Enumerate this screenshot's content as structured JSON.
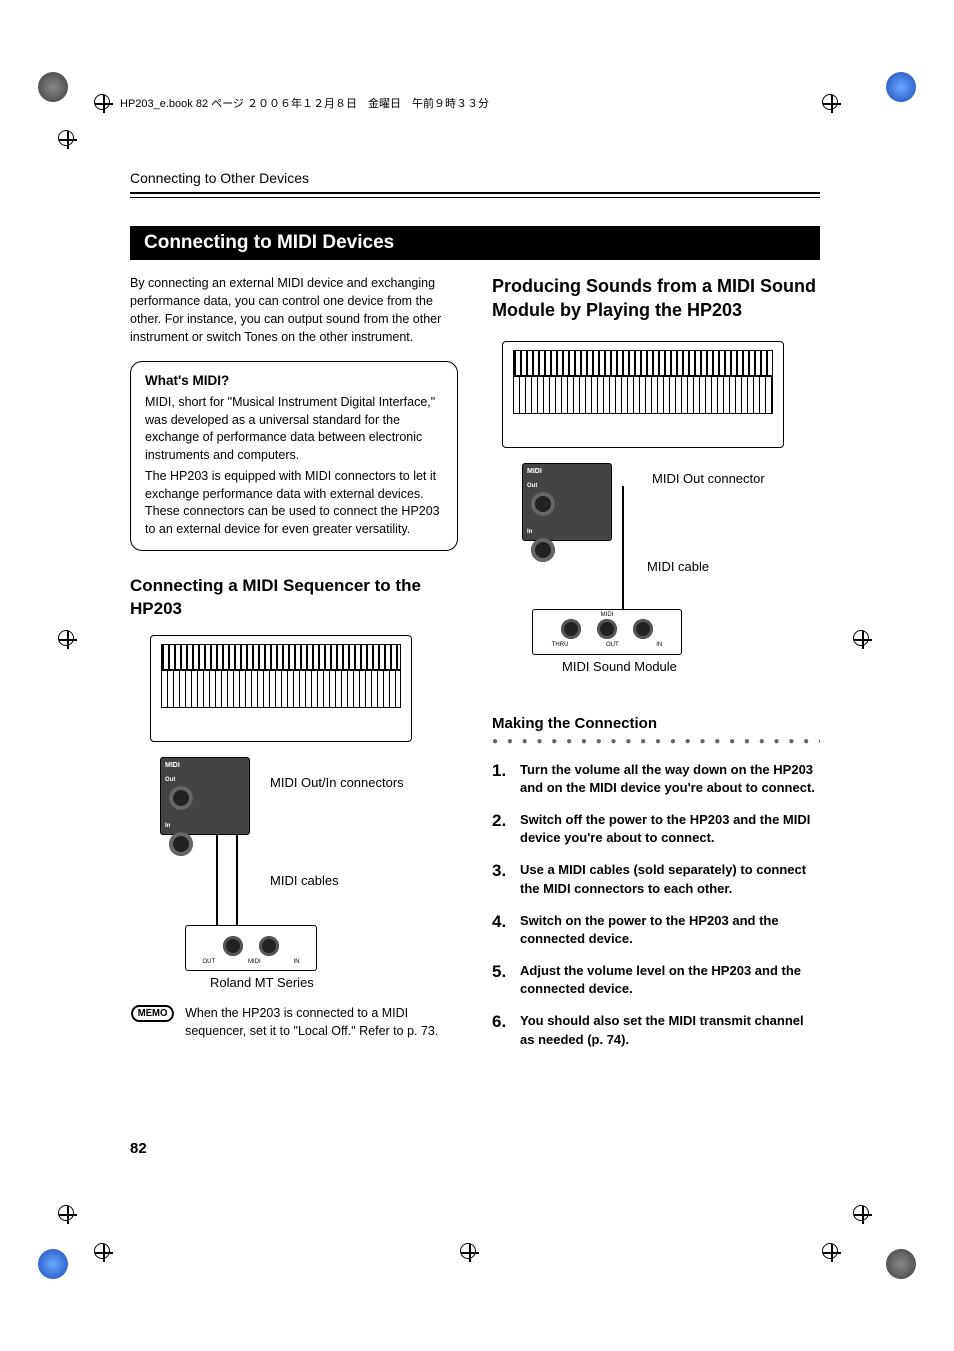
{
  "header_jp": "HP203_e.book  82 ページ  ２００６年１２月８日　金曜日　午前９時３３分",
  "breadcrumb": "Connecting to Other Devices",
  "section_title": "Connecting to MIDI Devices",
  "intro": "By connecting an external MIDI device and exchanging performance data, you can control one device from the other. For instance, you can output sound from the other instrument or switch Tones on the other instrument.",
  "callout": {
    "title": "What's MIDI?",
    "p1": "MIDI, short for \"Musical Instrument Digital Interface,\" was developed as a universal standard for the exchange of performance data between electronic instruments and computers.",
    "p2": "The HP203 is equipped with MIDI connectors to let it exchange performance data with external devices. These connectors can be used to connect the HP203 to an external device for even greater versatility."
  },
  "left": {
    "heading": "Connecting a MIDI Sequencer to the HP203",
    "label_connectors": "MIDI Out/In connectors",
    "label_cables": "MIDI cables",
    "label_unit": "Roland MT Series",
    "panel_midi": "MIDI",
    "panel_out": "Out",
    "panel_in": "In",
    "ext_out": "OUT",
    "ext_midi": "MIDI",
    "ext_in": "IN"
  },
  "memo": {
    "label": "MEMO",
    "text": "When the HP203 is connected to a MIDI sequencer, set it to \"Local Off.\" Refer to p. 73."
  },
  "right": {
    "heading": "Producing Sounds from a MIDI Sound Module by Playing the HP203",
    "label_out": "MIDI Out connector",
    "label_cable": "MIDI cable",
    "label_module": "MIDI Sound Module",
    "panel_midi": "MIDI",
    "panel_out": "Out",
    "panel_in": "In",
    "ext_thru": "THRU",
    "ext_out_port": "OUT",
    "ext_in_port": "IN",
    "ext_header": "MIDI"
  },
  "making_connection": "Making the Connection",
  "steps": [
    "Turn the volume all the way down on the HP203 and on the MIDI device you're about to connect.",
    "Switch off the power to the HP203 and the MIDI device you're about to connect.",
    "Use a MIDI cables (sold separately) to connect the MIDI connectors to each other.",
    "Switch on the power to the HP203 and the connected device.",
    "Adjust the volume level on the HP203 and the connected device.",
    "You should also set the MIDI transmit channel as needed (p. 74)."
  ],
  "page_number": "82"
}
